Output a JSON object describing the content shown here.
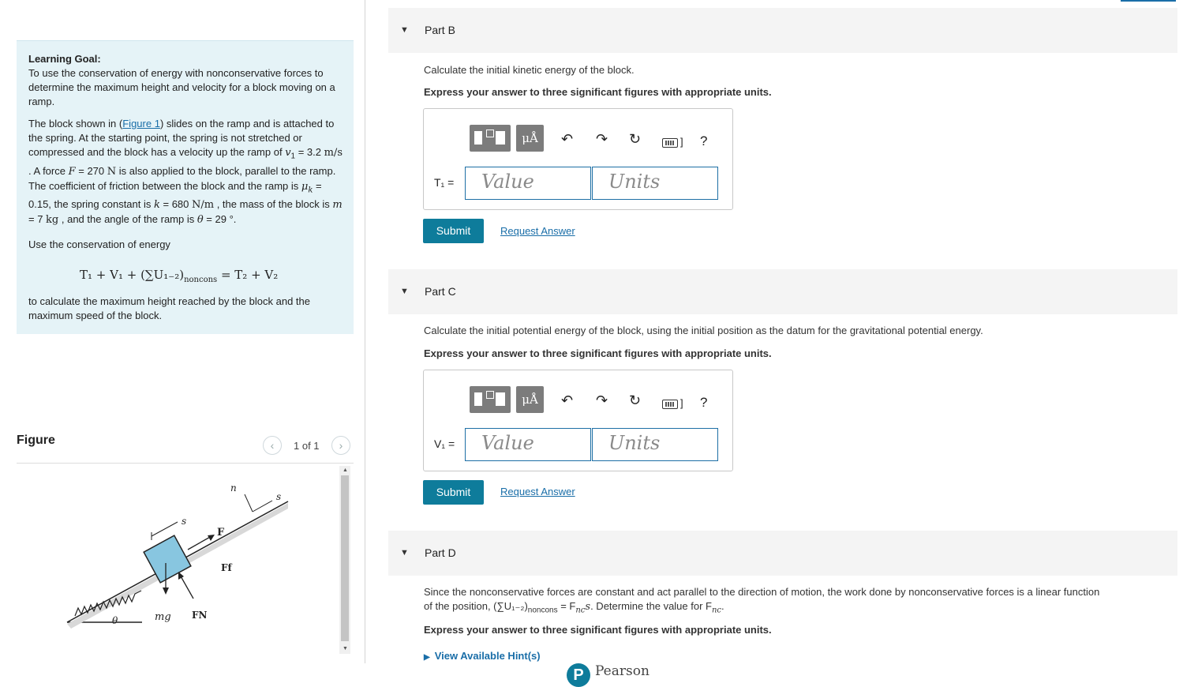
{
  "learning_goal": {
    "title": "Learning Goal:",
    "text": "To use the conservation of energy with nonconservative forces to determine the maximum height and velocity for a block moving on a ramp.",
    "para_start": "The block shown in (",
    "figure_link": "Figure 1",
    "para_rest": ") slides on the ramp and is attached to the spring. At the starting point, the spring is not stretched or compressed and the block has a velocity up the ramp of ",
    "v1_sym": "v",
    "v1_sub": "1",
    "v1_val": " = 3.2 ",
    "v1_unit": "m/s",
    "force_text": " . A force ",
    "force_sym": "F",
    "force_val": " = 270 ",
    "force_unit": "N",
    "friction_text": " is also applied to the block, parallel to the ramp. The coefficient of friction between the block and the ramp is ",
    "mu_sym": "μ",
    "mu_sub": "k",
    "mu_val": " = 0.15, the spring constant is ",
    "k_sym": "k",
    "k_val": " = 680 ",
    "k_unit": "N/m",
    "mass_text": " , the mass of the block is ",
    "m_sym": "m",
    "m_val": " = 7 ",
    "m_unit": "kg",
    "angle_text": " , and the angle of the ramp is ",
    "theta_sym": "θ",
    "theta_val": " = 29 °.",
    "use_text": "Use the conservation of energy",
    "equation": "T₁ + V₁ + (∑U₁₋₂)",
    "equation_sub": "noncons",
    "equation_end": " = T₂ + V₂",
    "to_calc": "to calculate the maximum height reached by the block and the maximum speed of the block."
  },
  "figure": {
    "title": "Figure",
    "pager": "1 of 1",
    "prev_icon": "chevron-left-icon",
    "next_icon": "chevron-right-icon",
    "labels": {
      "n": "n",
      "s1": "s",
      "s2": "s",
      "F": "F",
      "Ff": "Ff",
      "mg": "mg",
      "FN": "FN",
      "theta": "θ"
    }
  },
  "parts": {
    "b": {
      "label": "Part B",
      "question": "Calculate the initial kinetic energy of the block.",
      "instruction": "Express your answer to three significant figures with appropriate units.",
      "var_label": "T₁ =",
      "value_placeholder": "Value",
      "units_placeholder": "Units",
      "submit": "Submit",
      "request": "Request Answer"
    },
    "c": {
      "label": "Part C",
      "question": "Calculate the initial potential energy of the block, using the initial position as the datum for the gravitational potential energy.",
      "instruction": "Express your answer to three significant figures with appropriate units.",
      "var_label": "V₁ =",
      "value_placeholder": "Value",
      "units_placeholder": "Units",
      "submit": "Submit",
      "request": "Request Answer"
    },
    "d": {
      "label": "Part D",
      "question_1": "Since the nonconservative forces are constant and act parallel to the direction of motion, the work done by nonconservative forces is a linear function",
      "question_2a": "of the position, (∑U₁₋₂)",
      "question_2sub": "noncons",
      "question_2b": " = F",
      "question_2c": "nc",
      "question_2d": "s",
      "question_2e": ". Determine the value for F",
      "question_2f": "nc",
      "question_2g": ".",
      "instruction": "Express your answer to three significant figures with appropriate units.",
      "hint": "View Available Hint(s)"
    }
  },
  "toolbar": {
    "mu_label": "μÅ",
    "undo_icon": "undo-icon",
    "redo_icon": "redo-icon",
    "reset_icon": "reset-icon",
    "keyboard_icon": "keyboard-icon",
    "help_label": "?"
  },
  "footer": {
    "pearson_logo": "P",
    "pearson": "Pearson"
  }
}
